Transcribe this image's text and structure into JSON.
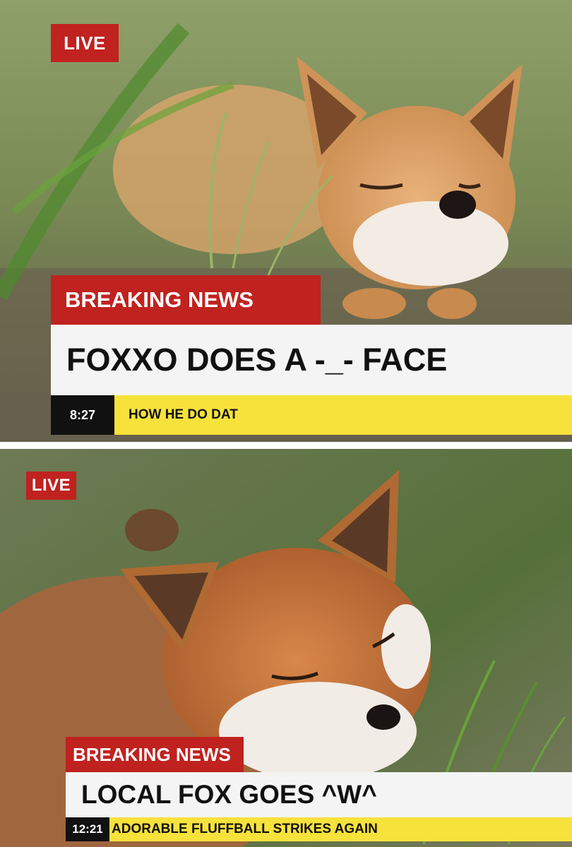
{
  "panels": [
    {
      "live_label": "LIVE",
      "breaking_label": "BREAKING NEWS",
      "headline": "FOXXO DOES A -_- FACE",
      "time": "8:27",
      "ticker": "HOW HE DO DAT"
    },
    {
      "live_label": "LIVE",
      "breaking_label": "BREAKING NEWS",
      "headline": "LOCAL FOX GOES ^W^",
      "time": "12:21",
      "ticker": "ADORABLE FLUFFBALL STRIKES AGAIN"
    }
  ],
  "colors": {
    "news_red": "#c0221f",
    "ticker_yellow": "#f7e23b",
    "headline_bg": "#f4f4f4",
    "time_bg": "#111111"
  }
}
